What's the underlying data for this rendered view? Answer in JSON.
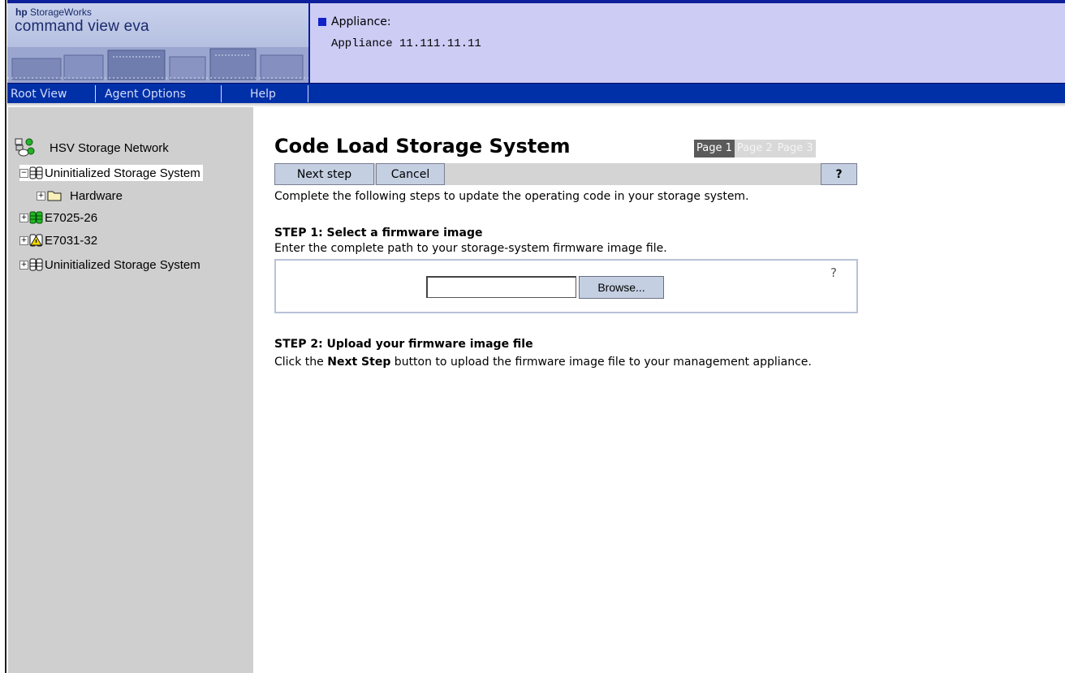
{
  "header": {
    "brand_hp": "hp",
    "brand_storageworks": "StorageWorks",
    "product": "command view eva",
    "appliance_label": "Appliance:",
    "appliance_value": "Appliance 11.111.11.11"
  },
  "nav": {
    "items": [
      "Root View",
      "Agent Options",
      "Help"
    ]
  },
  "tree": {
    "network": "HSV Storage Network",
    "nodes": [
      {
        "label": "Uninitialized Storage System",
        "expander": "−",
        "selected": true,
        "icon": "storage-system-icon"
      },
      {
        "label": "Hardware",
        "expander": "+",
        "selected": false,
        "icon": "folder-icon"
      },
      {
        "label": "E7025-26",
        "expander": "+",
        "selected": false,
        "icon": "storage-system-green-icon"
      },
      {
        "label": "E7031-32",
        "expander": "+",
        "selected": false,
        "icon": "storage-system-warning-icon"
      },
      {
        "label": "Uninitialized Storage System",
        "expander": "+",
        "selected": false,
        "icon": "storage-system-icon"
      }
    ]
  },
  "main": {
    "title": "Code Load Storage System",
    "pages": [
      "Page 1",
      "Page 2",
      "Page 3"
    ],
    "current_page": 1,
    "toolbar": {
      "next": "Next step",
      "cancel": "Cancel",
      "help": "?"
    },
    "description": "Complete the following steps to update the operating code in your storage system.",
    "step1": {
      "heading": "STEP 1: Select a firmware image",
      "text": "Enter the complete path to your storage-system firmware image file.",
      "input_value": "",
      "browse_label": "Browse...",
      "help_icon": "?"
    },
    "step2": {
      "heading": "STEP 2: Upload your firmware image file",
      "text_before": "Click the ",
      "text_bold": "Next Step",
      "text_after": " button to upload the firmware image file to your management appliance."
    }
  },
  "colors": {
    "navbar": "#0030a8",
    "appliance_bg": "#ccccf5",
    "tree_bg": "#cfcfcf",
    "button_bg": "#c4cfe2",
    "page_current": "#5a5a5a"
  }
}
